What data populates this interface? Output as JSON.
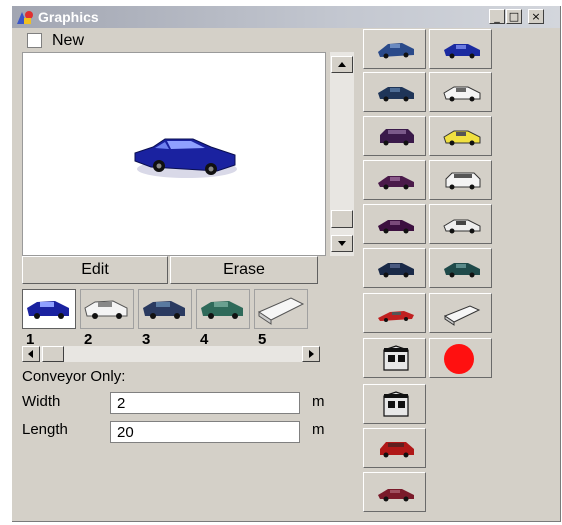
{
  "window": {
    "title": "Graphics",
    "controls": {
      "minimize": "_",
      "maximize": "□",
      "close": "×"
    }
  },
  "new_checkbox": {
    "label": "New",
    "checked": false
  },
  "preview": {
    "icon": "blue-sedan-icon"
  },
  "buttons": {
    "edit": "Edit",
    "erase": "Erase"
  },
  "thumbnails": [
    {
      "number": "1",
      "icon": "blue-sedan-icon",
      "selected": true
    },
    {
      "number": "2",
      "icon": "white-car-icon",
      "selected": false
    },
    {
      "number": "3",
      "icon": "dark-blue-car-icon",
      "selected": false
    },
    {
      "number": "4",
      "icon": "green-car-icon",
      "selected": false
    },
    {
      "number": "5",
      "icon": "white-trailer-icon",
      "selected": false
    }
  ],
  "conveyor": {
    "heading": "Conveyor Only:",
    "width_label": "Width",
    "width_value": "2",
    "width_unit": "m",
    "length_label": "Length",
    "length_value": "20",
    "length_unit": "m"
  },
  "palette": {
    "left_column": [
      "blue-car-icon",
      "dark-blue-car-icon",
      "purple-van-icon",
      "purple-car-icon",
      "purple-sedan-icon",
      "navy-car-icon",
      "red-sports-car-icon",
      "booth-icon",
      "booth-icon",
      "red-suv-icon",
      "maroon-car-icon"
    ],
    "right_column": [
      "blue-car-icon",
      "white-car-icon",
      "yellow-car-icon",
      "white-van-icon",
      "white-sedan-icon",
      "green-car-icon",
      "white-trailer-icon",
      "red-circle-icon"
    ]
  },
  "colors": {
    "window_bg": "#d4d0c8",
    "titlebar": "#a2a6b2",
    "preview_car": "#1a22a0",
    "circle": "#ff1010"
  }
}
